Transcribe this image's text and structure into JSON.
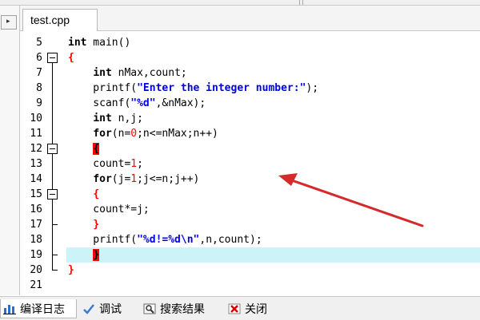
{
  "editor": {
    "tab_label": "test.cpp",
    "collapse_arrow": "▸",
    "lines": [
      {
        "n": "5",
        "tokens": [
          {
            "t": "int",
            "c": "kw"
          },
          {
            "t": " main()",
            "c": ""
          }
        ]
      },
      {
        "n": "6",
        "tokens": [
          {
            "t": "{",
            "c": "brace-red"
          }
        ]
      },
      {
        "n": "7",
        "tokens": [
          {
            "t": "    ",
            "c": ""
          },
          {
            "t": "int",
            "c": "kw"
          },
          {
            "t": " nMax,count;",
            "c": ""
          }
        ]
      },
      {
        "n": "8",
        "tokens": [
          {
            "t": "    printf(",
            "c": ""
          },
          {
            "t": "\"Enter the integer number:\"",
            "c": "str"
          },
          {
            "t": ");",
            "c": ""
          }
        ]
      },
      {
        "n": "9",
        "tokens": [
          {
            "t": "    scanf(",
            "c": ""
          },
          {
            "t": "\"%d\"",
            "c": "str"
          },
          {
            "t": ",&nMax);",
            "c": ""
          }
        ]
      },
      {
        "n": "10",
        "tokens": [
          {
            "t": "    ",
            "c": ""
          },
          {
            "t": "int",
            "c": "kw"
          },
          {
            "t": " n,j;",
            "c": ""
          }
        ]
      },
      {
        "n": "11",
        "tokens": [
          {
            "t": "    ",
            "c": ""
          },
          {
            "t": "for",
            "c": "kw"
          },
          {
            "t": "(n=",
            "c": ""
          },
          {
            "t": "0",
            "c": "num"
          },
          {
            "t": ";n<=nMax;n++)",
            "c": ""
          }
        ]
      },
      {
        "n": "12",
        "tokens": [
          {
            "t": "    ",
            "c": ""
          },
          {
            "t": "{",
            "c": "cursor-bg"
          }
        ]
      },
      {
        "n": "13",
        "tokens": [
          {
            "t": "    count=",
            "c": ""
          },
          {
            "t": "1",
            "c": "num"
          },
          {
            "t": ";",
            "c": ""
          }
        ]
      },
      {
        "n": "14",
        "tokens": [
          {
            "t": "    ",
            "c": ""
          },
          {
            "t": "for",
            "c": "kw"
          },
          {
            "t": "(j=",
            "c": ""
          },
          {
            "t": "1",
            "c": "num"
          },
          {
            "t": ";j<=n;j++)",
            "c": ""
          }
        ]
      },
      {
        "n": "15",
        "tokens": [
          {
            "t": "    ",
            "c": ""
          },
          {
            "t": "{",
            "c": "brace-red"
          }
        ]
      },
      {
        "n": "16",
        "tokens": [
          {
            "t": "    count*=j;",
            "c": ""
          }
        ]
      },
      {
        "n": "17",
        "tokens": [
          {
            "t": "    ",
            "c": ""
          },
          {
            "t": "}",
            "c": "brace-red"
          }
        ]
      },
      {
        "n": "18",
        "tokens": [
          {
            "t": "    printf(",
            "c": ""
          },
          {
            "t": "\"%d!=%d\\n\"",
            "c": "str"
          },
          {
            "t": ",n,count);",
            "c": ""
          }
        ]
      },
      {
        "n": "19",
        "tokens": [
          {
            "t": "    ",
            "c": ""
          },
          {
            "t": "}",
            "c": "cursor-bg"
          }
        ]
      },
      {
        "n": "20",
        "tokens": [
          {
            "t": "}",
            "c": "brace-red"
          }
        ]
      },
      {
        "n": "21",
        "tokens": []
      }
    ],
    "highlighted_line": "19",
    "fold_starts": [
      "6",
      "12",
      "15"
    ],
    "fold_ends": [
      "17",
      "19",
      "20"
    ]
  },
  "bottom_tabs": [
    {
      "label": "编译日志",
      "icon": "bar-chart-icon",
      "active": true
    },
    {
      "label": "调试",
      "icon": "check-icon",
      "active": false
    },
    {
      "label": "搜索结果",
      "icon": "search-icon",
      "active": false
    },
    {
      "label": "关闭",
      "icon": "close-icon",
      "active": false
    }
  ],
  "colors": {
    "keyword": "#000000",
    "string": "#0000e6",
    "number": "#ff0000",
    "brace": "#ff0000",
    "current_line": "#ccf3f7",
    "annotation_arrow": "#d42a2a"
  }
}
